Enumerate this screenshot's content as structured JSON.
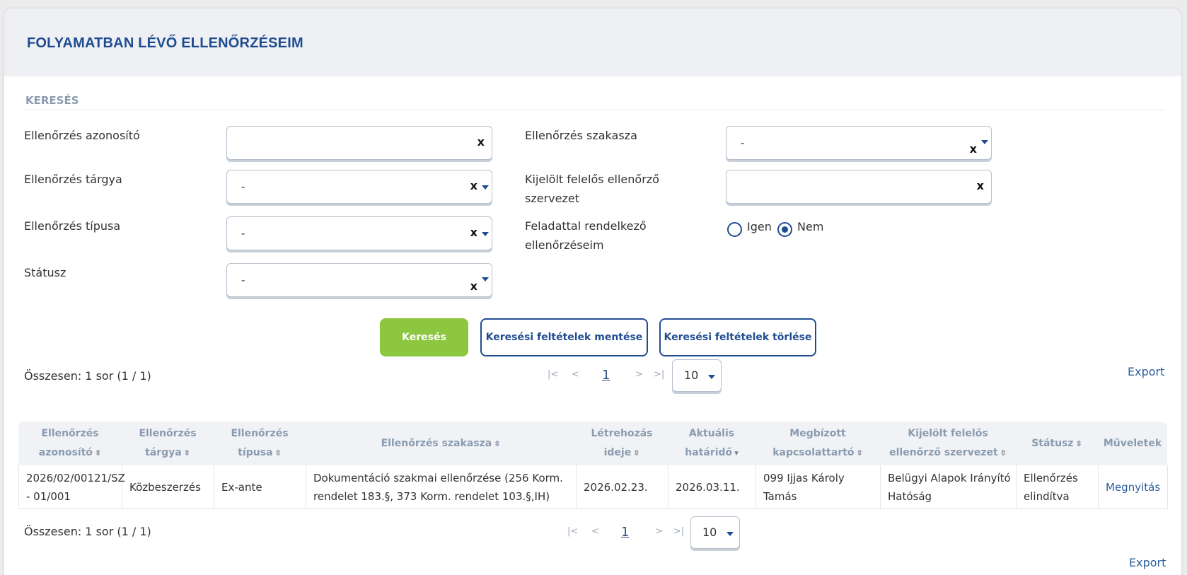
{
  "page": {
    "title": "FOLYAMATBAN LÉVŐ ELLENŐRZÉSEIM"
  },
  "search": {
    "section_title": "KERESÉS",
    "fields": {
      "azonosito": {
        "label": "Ellenőrzés azonosító",
        "value": "",
        "clear": "x"
      },
      "targya": {
        "label": "Ellenőrzés tárgya",
        "value": "-",
        "clear": "x"
      },
      "tipusa": {
        "label": "Ellenőrzés típusa",
        "value": "-",
        "clear": "x"
      },
      "statusz": {
        "label": "Státusz",
        "value": "-",
        "clear": "x"
      },
      "szakasza": {
        "label": "Ellenőrzés szakasza",
        "value": "-",
        "clear": "x"
      },
      "szervezet": {
        "label_line1": "Kijelölt felelős ellenőrző",
        "label_line2": "szervezet",
        "value": "",
        "clear": "x"
      },
      "feladattal": {
        "label_line1": "Feladattal rendelkező",
        "label_line2": "ellenőrzéseim",
        "options": [
          "Igen",
          "Nem"
        ],
        "selected": "Nem"
      }
    },
    "buttons": {
      "search": "Keresés",
      "save": "Keresési feltételek mentése",
      "clear": "Keresési feltételek törlése"
    }
  },
  "pagination": {
    "summary": "Összesen: 1 sor (1 / 1)",
    "current_page": "1",
    "page_size": "10",
    "export": "Export"
  },
  "table": {
    "headers": [
      {
        "line1": "Ellenőrzés",
        "line2": "azonosító",
        "sort": "⇳"
      },
      {
        "line1": "Ellenőrzés",
        "line2": "tárgya",
        "sort": "⇳"
      },
      {
        "line1": "Ellenőrzés",
        "line2": "típusa",
        "sort": "⇳"
      },
      {
        "line1": "Ellenőrzés szakasza",
        "line2": "",
        "sort": "⇳"
      },
      {
        "line1": "Létrehozás",
        "line2": "ideje",
        "sort": "⇳"
      },
      {
        "line1": "Aktuális",
        "line2": "határidő",
        "sort": "▾"
      },
      {
        "line1": "Megbízott",
        "line2": "kapcsolattartó",
        "sort": "⇳"
      },
      {
        "line1": "Kijelölt felelős",
        "line2": "ellenőrző szervezet",
        "sort": "⇳"
      },
      {
        "line1": "Státusz",
        "line2": "",
        "sort": "⇳"
      },
      {
        "line1": "Műveletek",
        "line2": "",
        "sort": ""
      }
    ],
    "rows": [
      {
        "azonosito": [
          "2026/02/00121/SZ",
          "- 01/001"
        ],
        "targya": "Közbeszerzés",
        "tipusa": "Ex-ante",
        "szakasza": [
          "Dokumentáció szakmai ellenőrzése (256 Korm.",
          "rendelet 183.§, 373 Korm. rendelet 103.§,IH)"
        ],
        "letrehozas": "2026.02.23.",
        "hatarido": "2026.03.11.",
        "kapcsolattarto": "099 Ijjas Károly Tamás",
        "szervezet": [
          "Belügyi Alapok Irányító",
          "Hatóság"
        ],
        "statusz": [
          "Ellenőrzés",
          "elindítva"
        ],
        "muvelet": "Megnyitás"
      }
    ]
  },
  "colors": {
    "brand_blue": "#1f4c91",
    "accent_green": "#8dc63f",
    "muted_gray": "#8a9bb0"
  }
}
